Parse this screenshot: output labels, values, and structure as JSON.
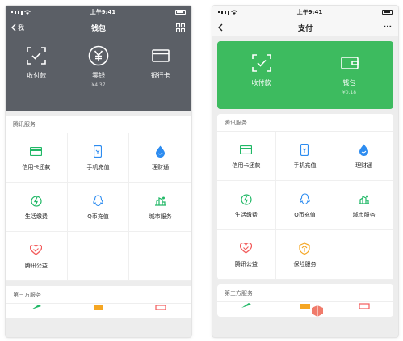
{
  "colors": {
    "grey_header": "#5b5f66",
    "green": "#3dbb5f"
  },
  "phone_a": {
    "status": {
      "time": "上午9:41"
    },
    "nav": {
      "back_label": "我",
      "title": "钱包"
    },
    "hero": [
      {
        "label": "收付款",
        "sub": ""
      },
      {
        "label": "零钱",
        "sub": "¥4.37"
      },
      {
        "label": "银行卡",
        "sub": ""
      }
    ],
    "tencent": {
      "title": "腾讯服务",
      "items": [
        "信用卡还款",
        "手机充值",
        "理财通",
        "生活缴费",
        "Q币充值",
        "城市服务",
        "腾讯公益"
      ]
    },
    "third": {
      "title": "第三方服务"
    }
  },
  "phone_b": {
    "status": {
      "time": "上午9:41"
    },
    "nav": {
      "title": "支付",
      "more": "···"
    },
    "hero": [
      {
        "label": "收付款",
        "sub": ""
      },
      {
        "label": "钱包",
        "sub": "¥0.18"
      }
    ],
    "tencent": {
      "title": "腾讯服务",
      "items": [
        "信用卡还款",
        "手机充值",
        "理财通",
        "生活缴费",
        "Q币充值",
        "城市服务",
        "腾讯公益",
        "保险服务"
      ]
    },
    "third": {
      "title": "第三方服务"
    }
  }
}
